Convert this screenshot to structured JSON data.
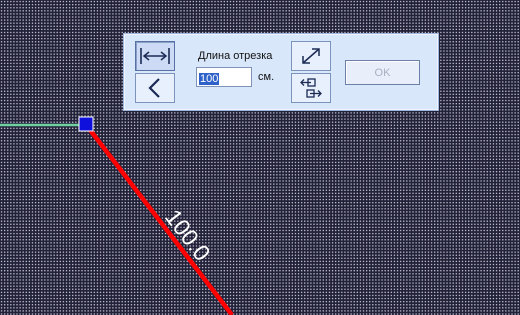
{
  "toolbar": {
    "length_label": "Длина отрезка",
    "length_value": "100",
    "unit": "см.",
    "ok_label": "OK",
    "buttons": {
      "length_mode": "segment-length-icon",
      "angle_mode": "angle-icon",
      "resize": "diagonal-arrows-icon",
      "direction": "direction-toggle-icon"
    },
    "ok_enabled": false
  },
  "canvas": {
    "segment_label": "100.0",
    "colors": {
      "background": "#22213a",
      "grid": "#b9b9c4",
      "previous_segment": "#6fd2a0",
      "current_segment": "#ff0000",
      "vertex": "#1010dd"
    }
  }
}
